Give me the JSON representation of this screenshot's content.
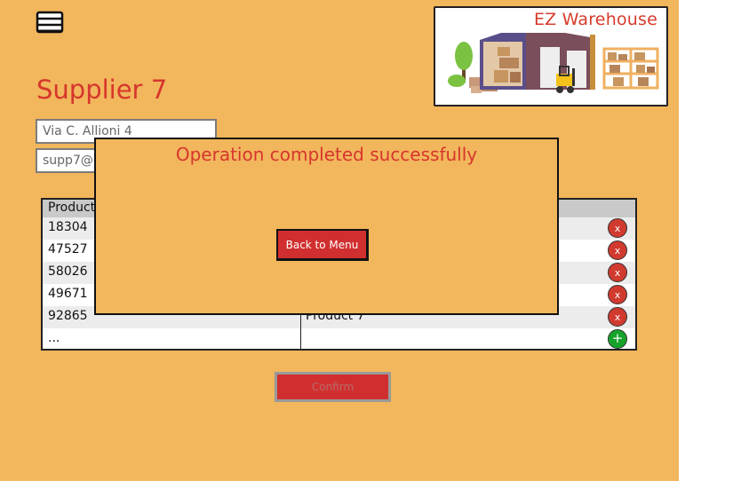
{
  "header": {
    "menu_icon": "hamburger-menu-icon"
  },
  "logo": {
    "title": "EZ Warehouse"
  },
  "page": {
    "title": "Supplier 7"
  },
  "form": {
    "address_value": "Via C. Allioni 4",
    "email_value": "supp7@"
  },
  "table": {
    "headers": [
      "Product",
      ""
    ],
    "rows": [
      {
        "id": "18304",
        "name": ""
      },
      {
        "id": "47527",
        "name": ""
      },
      {
        "id": "58026",
        "name": ""
      },
      {
        "id": "49671",
        "name": ""
      },
      {
        "id": "92865",
        "name": "Product 7"
      }
    ],
    "ellipsis": "...",
    "delete_label": "x",
    "add_label": "+"
  },
  "actions": {
    "confirm_label": "Confirm"
  },
  "modal": {
    "message": "Operation completed successfully",
    "back_label": "Back to Menu"
  },
  "colors": {
    "background": "#f2b65c",
    "accent_red": "#d6362d",
    "add_green": "#16a32a"
  }
}
